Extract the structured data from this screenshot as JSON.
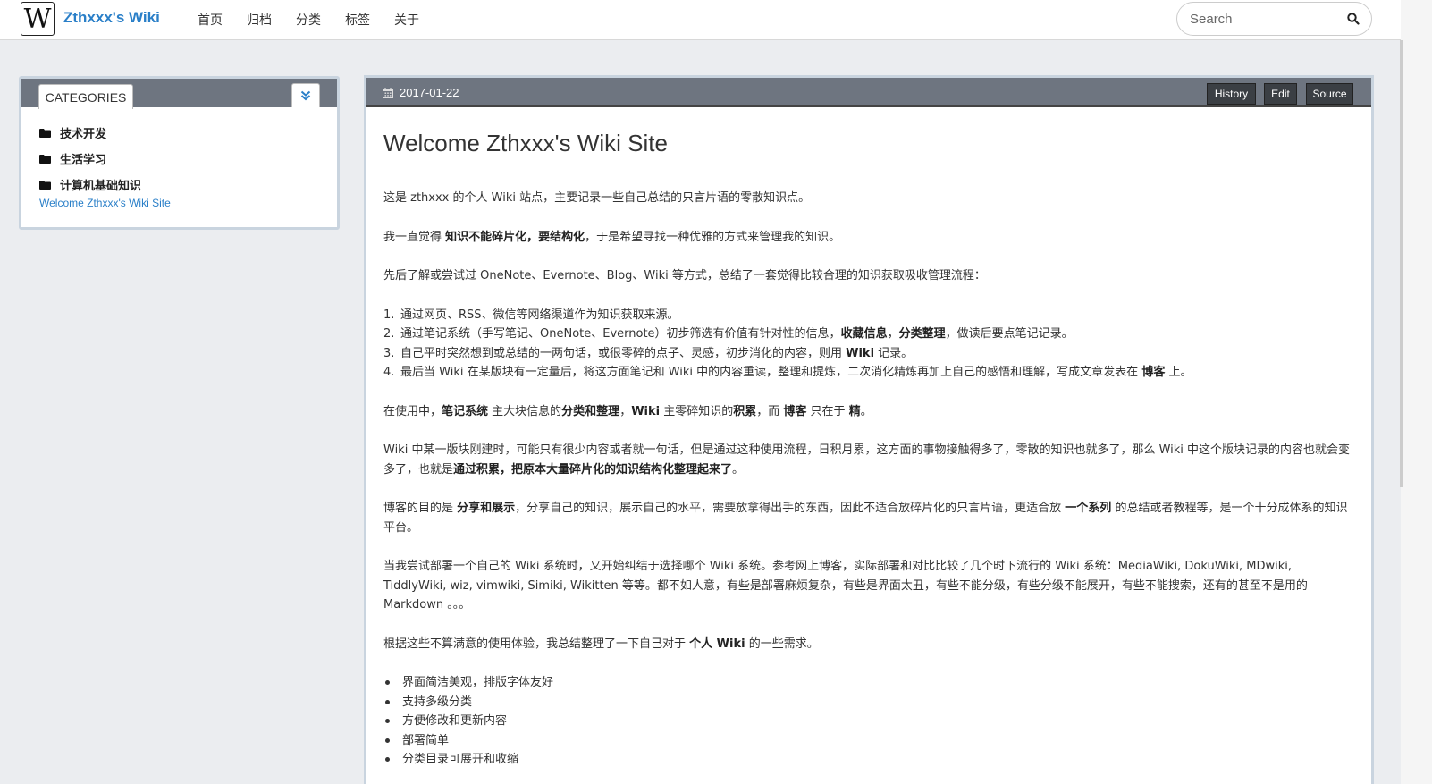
{
  "header": {
    "logo_letter": "W",
    "brand": "Zthxxx's Wiki",
    "nav": [
      "首页",
      "归档",
      "分类",
      "标签",
      "关于"
    ],
    "search_placeholder": "Search"
  },
  "sidebar": {
    "tab_label": "CATEGORIES",
    "categories": [
      "技术开发",
      "生活学习",
      "计算机基础知识"
    ],
    "page_link": "Welcome Zthxxx's Wiki Site"
  },
  "article": {
    "date": "2017-01-22",
    "actions": [
      "History",
      "Edit",
      "Source"
    ],
    "title": "Welcome Zthxxx's Wiki Site",
    "p1": "这是 zthxxx 的个人 Wiki 站点，主要记录一些自己总结的只言片语的零散知识点。",
    "p2_pre": "我一直觉得 ",
    "p2_bold": "知识不能碎片化，要结构化",
    "p2_post": "，于是希望寻找一种优雅的方式来管理我的知识。",
    "p3": "先后了解或尝试过 OneNote、Evernote、Blog、Wiki 等方式，总结了一套觉得比较合理的知识获取吸收管理流程：",
    "steps": [
      {
        "num": "1.",
        "pre": "通过网页、RSS、微信等网络渠道作为知识获取来源。"
      },
      {
        "num": "2.",
        "pre": "通过笔记系统（手写笔记、OneNote、Evernote）初步筛选有价值有针对性的信息，",
        "b1": "收藏信息",
        "mid": "，",
        "b2": "分类整理",
        "post": "，做读后要点笔记记录。"
      },
      {
        "num": "3.",
        "pre": "自己平时突然想到或总结的一两句话，或很零碎的点子、灵感，初步消化的内容，则用 ",
        "b1": "Wiki",
        "post": " 记录。"
      },
      {
        "num": "4.",
        "pre": "最后当 Wiki 在某版块有一定量后，将这方面笔记和 Wiki 中的内容重读，整理和提炼，二次消化精炼再加上自己的感悟和理解，写成文章发表在 ",
        "b1": "博客",
        "post": " 上。"
      }
    ],
    "p4": {
      "t1": "在使用中，",
      "b1": "笔记系统",
      "t2": " 主大块信息的",
      "b2": "分类和整理",
      "t3": "，",
      "b3": "Wiki",
      "t4": " 主零碎知识的",
      "b4": "积累",
      "t5": "，而 ",
      "b5": "博客",
      "t6": " 只在于 ",
      "b6": "精",
      "t7": "。"
    },
    "p5": {
      "t1": "Wiki 中某一版块刚建时，可能只有很少内容或者就一句话，但是通过这种使用流程，日积月累，这方面的事物接触得多了，零散的知识也就多了，那么 Wiki 中这个版块记录的内容也就会变多了，也就是",
      "b1": "通过积累，把原本大量碎片化的知识结构化整理起来了",
      "t2": "。"
    },
    "p6": {
      "t1": "博客的目的是 ",
      "b1": "分享和展示",
      "t2": "，分享自己的知识，展示自己的水平，需要放拿得出手的东西，因此不适合放碎片化的只言片语，更适合放 ",
      "b2": "一个系列",
      "t3": " 的总结或者教程等，是一个十分成体系的知识平台。"
    },
    "p7": "当我尝试部署一个自己的 Wiki 系统时，又开始纠结于选择哪个 Wiki 系统。参考网上博客，实际部署和对比比较了几个时下流行的 Wiki 系统：MediaWiki, DokuWiki, MDwiki, TiddlyWiki, wiz, vimwiki, Simiki, Wikitten 等等。都不如人意，有些是部署麻烦复杂，有些是界面太丑，有些不能分级，有些分级不能展开，有些不能搜索，还有的甚至不是用的 Markdown 。。。",
    "p8": {
      "t1": "根据这些不算满意的使用体验，我总结整理了一下自己对于 ",
      "b1": "个人 Wiki",
      "t2": " 的一些需求。"
    },
    "needs": [
      "界面简洁美观，排版字体友好",
      "支持多级分类",
      "方便修改和更新内容",
      "部署简单",
      "分类目录可展开和收缩"
    ]
  }
}
